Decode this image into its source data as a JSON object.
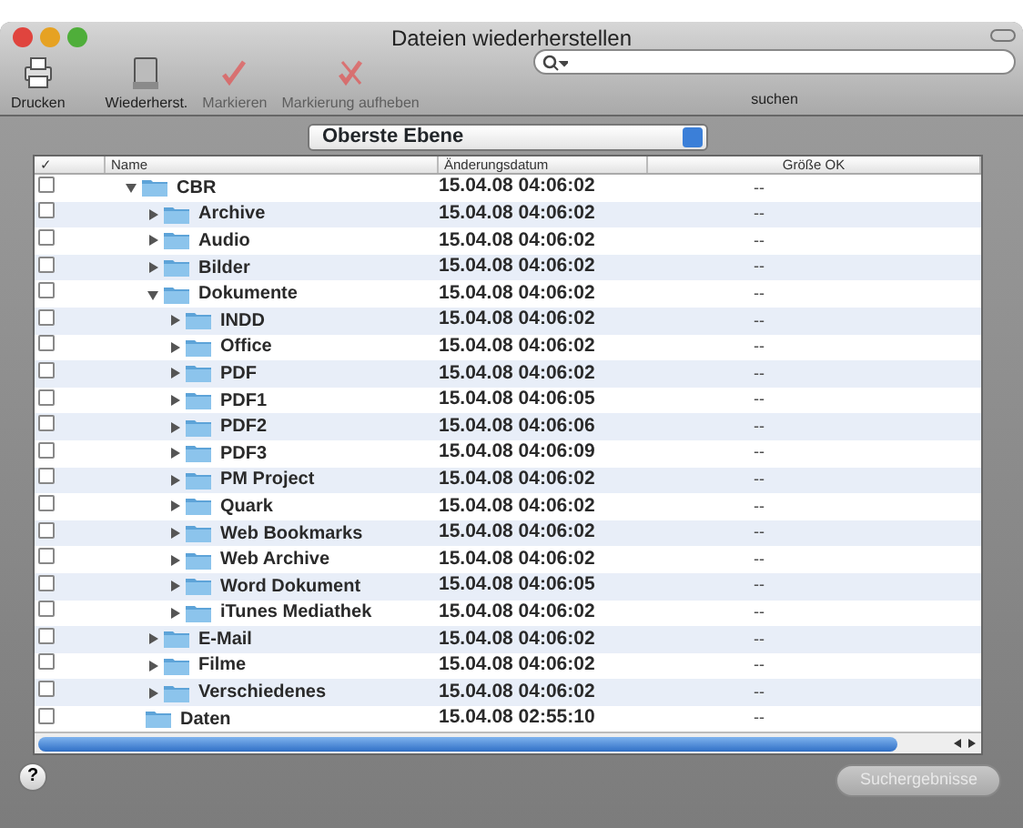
{
  "window": {
    "title": "Dateien wiederherstellen"
  },
  "toolbar": [
    {
      "label": "Drucken",
      "kind": "print",
      "disabled": false
    },
    {
      "label": "Wiederherst.",
      "kind": "restore",
      "disabled": false
    },
    {
      "label": "Markieren",
      "kind": "mark",
      "disabled": true
    },
    {
      "label": "Markierung aufheben",
      "kind": "unmark",
      "disabled": true
    }
  ],
  "search": {
    "label": "suchen"
  },
  "scope_popup": {
    "value": "Oberste Ebene"
  },
  "table": {
    "columns": [
      "✓",
      "Name",
      "Änderungsdatum",
      "Größe OK"
    ],
    "rows": [
      {
        "name": "CBR",
        "date": "15.04.08 04:06:02",
        "size": "--",
        "checked": false,
        "expanded": true,
        "children": [
          {
            "name": "Archive",
            "date": "15.04.08 04:06:02",
            "size": "--",
            "checked": false,
            "expanded": false
          },
          {
            "name": "Audio",
            "date": "15.04.08 04:06:02",
            "size": "--",
            "checked": false,
            "expanded": false
          },
          {
            "name": "Bilder",
            "date": "15.04.08 04:06:02",
            "size": "--",
            "checked": false,
            "expanded": false
          },
          {
            "name": "Dokumente",
            "date": "15.04.08 04:06:02",
            "size": "--",
            "checked": false,
            "expanded": true,
            "children": [
              {
                "name": "INDD",
                "date": "15.04.08 04:06:02",
                "size": "--",
                "checked": false,
                "expanded": false
              },
              {
                "name": "Office",
                "date": "15.04.08 04:06:02",
                "size": "--",
                "checked": false,
                "expanded": false
              },
              {
                "name": "PDF",
                "date": "15.04.08 04:06:02",
                "size": "--",
                "checked": false,
                "expanded": false
              },
              {
                "name": "PDF1",
                "date": "15.04.08 04:06:05",
                "size": "--",
                "checked": false,
                "expanded": false
              },
              {
                "name": "PDF2",
                "date": "15.04.08 04:06:06",
                "size": "--",
                "checked": false,
                "expanded": false
              },
              {
                "name": "PDF3",
                "date": "15.04.08 04:06:09",
                "size": "--",
                "checked": false,
                "expanded": false
              },
              {
                "name": "PM Project",
                "date": "15.04.08 04:06:02",
                "size": "--",
                "checked": false,
                "expanded": false
              },
              {
                "name": "Quark",
                "date": "15.04.08 04:06:02",
                "size": "--",
                "checked": false,
                "expanded": false
              },
              {
                "name": "Web Bookmarks",
                "date": "15.04.08 04:06:02",
                "size": "--",
                "checked": false,
                "expanded": false
              },
              {
                "name": "Web Archive",
                "date": "15.04.08 04:06:02",
                "size": "--",
                "checked": false,
                "expanded": false
              },
              {
                "name": "Word Dokument",
                "date": "15.04.08 04:06:05",
                "size": "--",
                "checked": false,
                "expanded": false
              },
              {
                "name": "iTunes Mediathek",
                "date": "15.04.08 04:06:02",
                "size": "--",
                "checked": false,
                "expanded": false
              }
            ]
          },
          {
            "name": "E-Mail",
            "date": "15.04.08 04:06:02",
            "size": "--",
            "checked": false,
            "expanded": false
          },
          {
            "name": "Filme",
            "date": "15.04.08 04:06:02",
            "size": "--",
            "checked": false,
            "expanded": false
          },
          {
            "name": "Verschiedenes",
            "date": "15.04.08 04:06:02",
            "size": "--",
            "checked": false,
            "expanded": false
          }
        ]
      },
      {
        "name": "Daten",
        "date": "15.04.08 02:55:10",
        "size": "--",
        "checked": false
      }
    ]
  },
  "help_button": {
    "label": "?"
  },
  "buttons": [
    {
      "label": "Suchergebnisse",
      "disabled": true
    }
  ]
}
